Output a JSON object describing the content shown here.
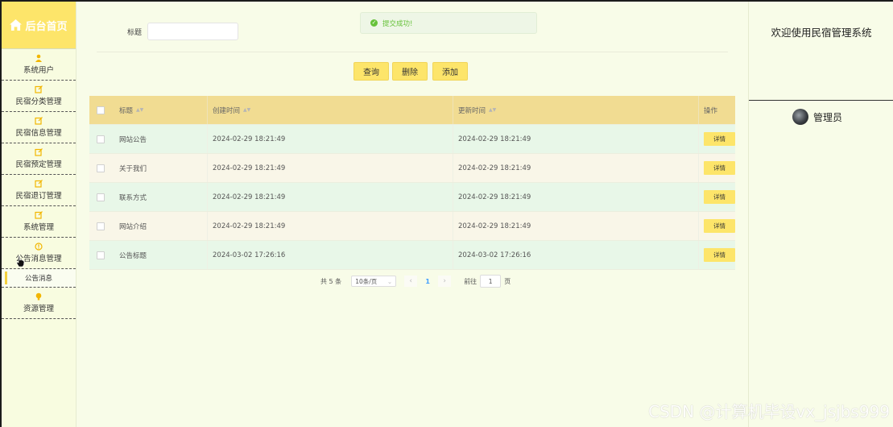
{
  "sidebar": {
    "home": "后台首页",
    "items": [
      {
        "label": "系统用户",
        "icon": "user-icon"
      },
      {
        "label": "民宿分类管理",
        "icon": "edit-icon"
      },
      {
        "label": "民宿信息管理",
        "icon": "edit-icon"
      },
      {
        "label": "民宿预定管理",
        "icon": "edit-icon"
      },
      {
        "label": "民宿退订管理",
        "icon": "edit-icon"
      },
      {
        "label": "系统管理",
        "icon": "edit-icon"
      },
      {
        "label": "公告消息管理",
        "icon": "info-icon"
      }
    ],
    "sub_item": "公告消息",
    "last_item": {
      "label": "资源管理",
      "icon": "bulb-icon"
    }
  },
  "toast": {
    "message": "提交成功!",
    "color": "#67c23a"
  },
  "search": {
    "label": "标题",
    "value": ""
  },
  "buttons": {
    "query": "查询",
    "delete": "删除",
    "add": "添加"
  },
  "table": {
    "headers": {
      "title": "标题",
      "created": "创建时间",
      "updated": "更新时间",
      "op": "操作"
    },
    "rows": [
      {
        "title": "网站公告",
        "created": "2024-02-29 18:21:49",
        "updated": "2024-02-29 18:21:49",
        "op": "详情"
      },
      {
        "title": "关于我们",
        "created": "2024-02-29 18:21:49",
        "updated": "2024-02-29 18:21:49",
        "op": "详情"
      },
      {
        "title": "联系方式",
        "created": "2024-02-29 18:21:49",
        "updated": "2024-02-29 18:21:49",
        "op": "详情"
      },
      {
        "title": "网站介绍",
        "created": "2024-02-29 18:21:49",
        "updated": "2024-02-29 18:21:49",
        "op": "详情"
      },
      {
        "title": "公告标题",
        "created": "2024-03-02 17:26:16",
        "updated": "2024-03-02 17:26:16",
        "op": "详情"
      }
    ]
  },
  "pagination": {
    "total": "共 5 条",
    "page_size": "10条/页",
    "current_page": "1",
    "goto_label": "前往",
    "goto_value": "1",
    "page_suffix": "页"
  },
  "right_panel": {
    "welcome": "欢迎使用民宿管理系统",
    "user": "管理员"
  },
  "watermark": "CSDN @计算机毕设vx_jsjbs999",
  "colors": {
    "accent": "#fde56a",
    "header": "#f1dc92",
    "bg": "#f8fce8"
  }
}
